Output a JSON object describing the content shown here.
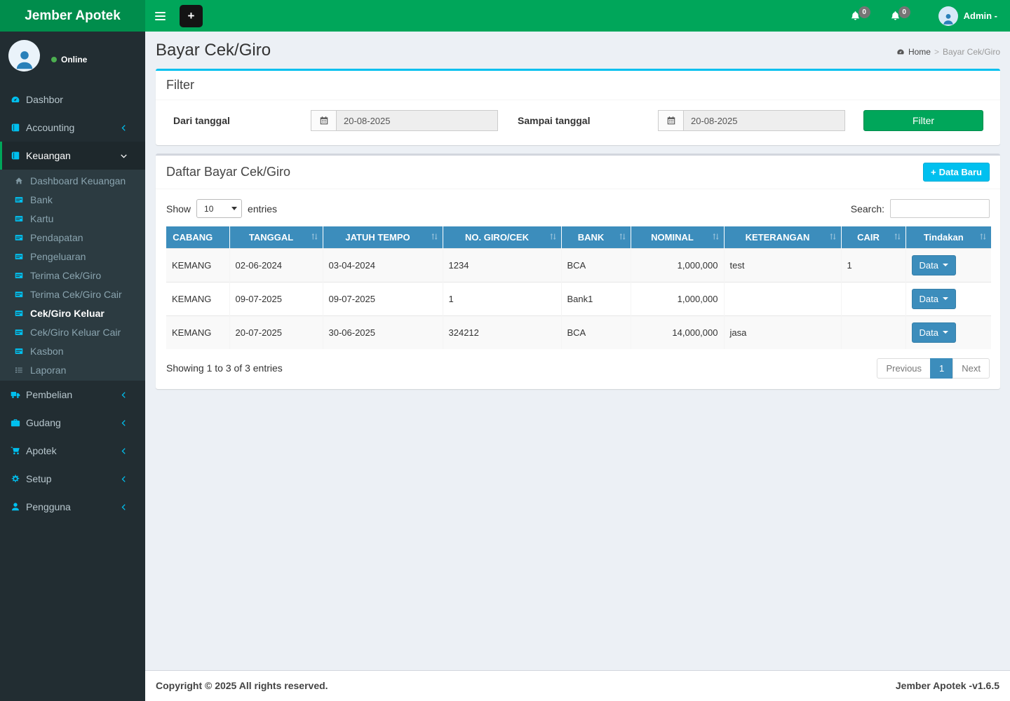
{
  "colors": {
    "navbar_green": "#00a65a",
    "logo_green": "#008d4c",
    "accent_cyan": "#00c0ef",
    "table_header_blue": "#3c8dbc",
    "sidebar_dark": "#222d32",
    "sidebar_submenu": "#2c3b41"
  },
  "navbar": {
    "brand": "Jember Apotek",
    "bell1_badge": "0",
    "bell2_badge": "0",
    "user_label": "Admin -"
  },
  "sidebar": {
    "status": "Online",
    "items": [
      {
        "label": "Dashbor",
        "icon": "gauge-icon"
      },
      {
        "label": "Accounting",
        "icon": "book-icon",
        "chevron": "left"
      },
      {
        "label": "Keuangan",
        "icon": "book-icon",
        "chevron": "down",
        "active": true,
        "children": [
          {
            "label": "Dashboard Keuangan",
            "icon": "home-icon"
          },
          {
            "label": "Bank",
            "icon": "credit-card-icon"
          },
          {
            "label": "Kartu",
            "icon": "credit-card-icon"
          },
          {
            "label": "Pendapatan",
            "icon": "credit-card-icon"
          },
          {
            "label": "Pengeluaran",
            "icon": "credit-card-icon"
          },
          {
            "label": "Terima Cek/Giro",
            "icon": "credit-card-icon"
          },
          {
            "label": "Terima Cek/Giro Cair",
            "icon": "credit-card-icon"
          },
          {
            "label": "Cek/Giro Keluar",
            "icon": "credit-card-icon",
            "active": true
          },
          {
            "label": "Cek/Giro Keluar Cair",
            "icon": "credit-card-icon"
          },
          {
            "label": "Kasbon",
            "icon": "credit-card-icon"
          },
          {
            "label": "Laporan",
            "icon": "list-icon"
          }
        ]
      },
      {
        "label": "Pembelian",
        "icon": "truck-icon",
        "chevron": "left"
      },
      {
        "label": "Gudang",
        "icon": "briefcase-icon",
        "chevron": "left"
      },
      {
        "label": "Apotek",
        "icon": "cart-icon",
        "chevron": "left"
      },
      {
        "label": "Setup",
        "icon": "gears-icon",
        "chevron": "left"
      },
      {
        "label": "Pengguna",
        "icon": "user-icon",
        "chevron": "left"
      }
    ]
  },
  "page": {
    "title": "Bayar Cek/Giro",
    "breadcrumb_home": "Home",
    "breadcrumb_sep": ">",
    "breadcrumb_current": "Bayar Cek/Giro"
  },
  "filter": {
    "title": "Filter",
    "from_label": "Dari tanggal",
    "from_value": "20-08-2025",
    "to_label": "Sampai tanggal",
    "to_value": "20-08-2025",
    "button": "Filter"
  },
  "list_box": {
    "title": "Daftar Bayar Cek/Giro",
    "new_button": "Data Baru",
    "show_label": "Show",
    "show_value": "10",
    "entries_label": "entries",
    "search_label": "Search:",
    "search_value": ""
  },
  "table": {
    "columns": [
      "CABANG",
      "TANGGAL",
      "JATUH TEMPO",
      "NO. GIRO/CEK",
      "BANK",
      "NOMINAL",
      "KETERANGAN",
      "CAIR",
      "Tindakan"
    ],
    "rows": [
      {
        "cells": [
          "KEMANG",
          "02-06-2024",
          "03-04-2024",
          "1234",
          "BCA",
          "1,000,000",
          "test",
          "1"
        ],
        "action": "Data"
      },
      {
        "cells": [
          "KEMANG",
          "09-07-2025",
          "09-07-2025",
          "1",
          "Bank1",
          "1,000,000",
          "",
          ""
        ],
        "action": "Data"
      },
      {
        "cells": [
          "KEMANG",
          "20-07-2025",
          "30-06-2025",
          "324212",
          "BCA",
          "14,000,000",
          "jasa",
          ""
        ],
        "action": "Data"
      }
    ],
    "info": "Showing 1 to 3 of 3 entries",
    "pagination": {
      "previous": "Previous",
      "page": "1",
      "next": "Next"
    }
  },
  "footer": {
    "left": "Copyright © 2025 All rights reserved.",
    "right": "Jember Apotek -v1.6.5"
  }
}
